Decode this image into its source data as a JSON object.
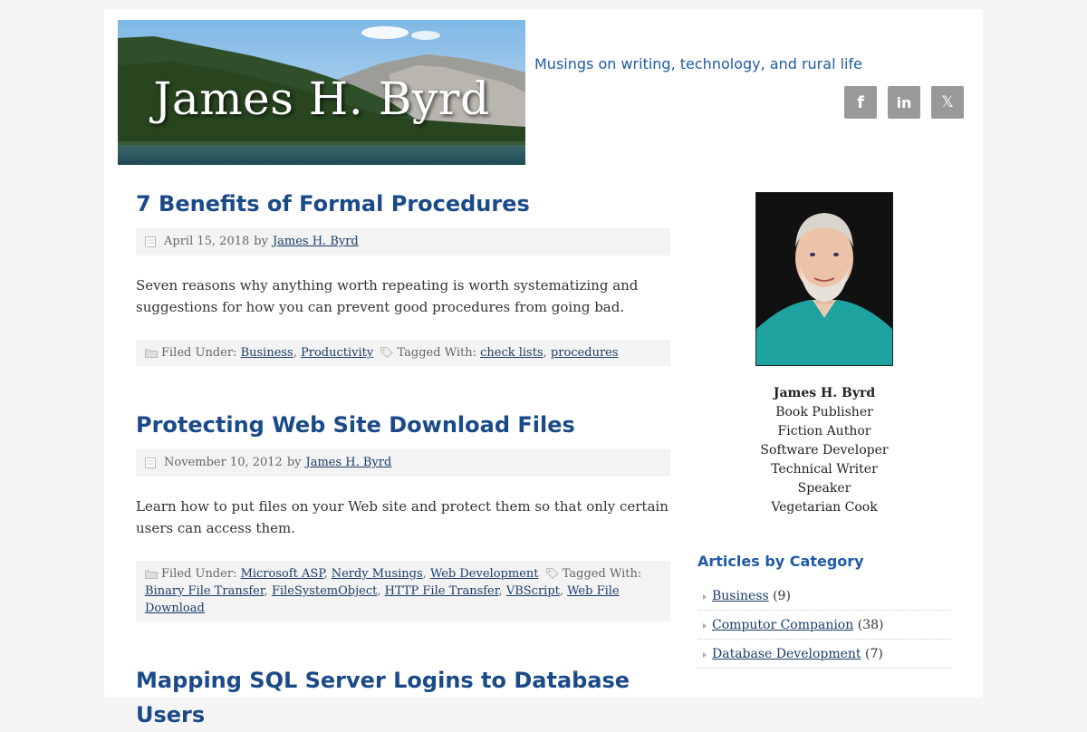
{
  "header": {
    "banner_title": "James H. Byrd",
    "tagline": "Musings on writing, technology, and rural life",
    "social": [
      {
        "name": "facebook",
        "glyph": "f"
      },
      {
        "name": "linkedin",
        "glyph": "in"
      },
      {
        "name": "x",
        "glyph": "𝕏"
      }
    ]
  },
  "posts": [
    {
      "title": "7 Benefits of Formal Procedures",
      "date": "April 15, 2018",
      "by": "by",
      "author": "James H. Byrd",
      "excerpt": "Seven reasons why anything worth repeating is worth systematizing and suggestions for how you can prevent good procedures from going bad.",
      "filed_label": "Filed Under:",
      "categories": [
        "Business",
        "Productivity"
      ],
      "tagged_label": "Tagged With:",
      "tags": [
        "check lists",
        "procedures"
      ]
    },
    {
      "title": "Protecting Web Site Download Files",
      "date": "November 10, 2012",
      "by": "by",
      "author": "James H. Byrd",
      "excerpt": "Learn how to put files on your Web site and protect them so that only certain users can access them.",
      "filed_label": "Filed Under:",
      "categories": [
        "Microsoft ASP",
        "Nerdy Musings",
        "Web Development"
      ],
      "tagged_label": "Tagged With:",
      "tags": [
        "Binary File Transfer",
        "FileSystemObject",
        "HTTP File Transfer",
        "VBScript",
        "Web File Download"
      ]
    },
    {
      "title": "Mapping SQL Server Logins to Database Users"
    }
  ],
  "sidebar": {
    "bio": {
      "name": "James H. Byrd",
      "roles": [
        "Book Publisher",
        "Fiction Author",
        "Software Developer",
        "Technical Writer",
        "Speaker",
        "Vegetarian Cook"
      ]
    },
    "categories_title": "Articles by Category",
    "categories": [
      {
        "label": "Business",
        "count": "(9)"
      },
      {
        "label": "Computor Companion",
        "count": "(38)"
      },
      {
        "label": "Database Development",
        "count": "(7)"
      }
    ]
  },
  "colors": {
    "link": "#1a3e6b",
    "title": "#1a4a8a",
    "accent": "#1e5ba7",
    "social_bg": "#999999"
  }
}
